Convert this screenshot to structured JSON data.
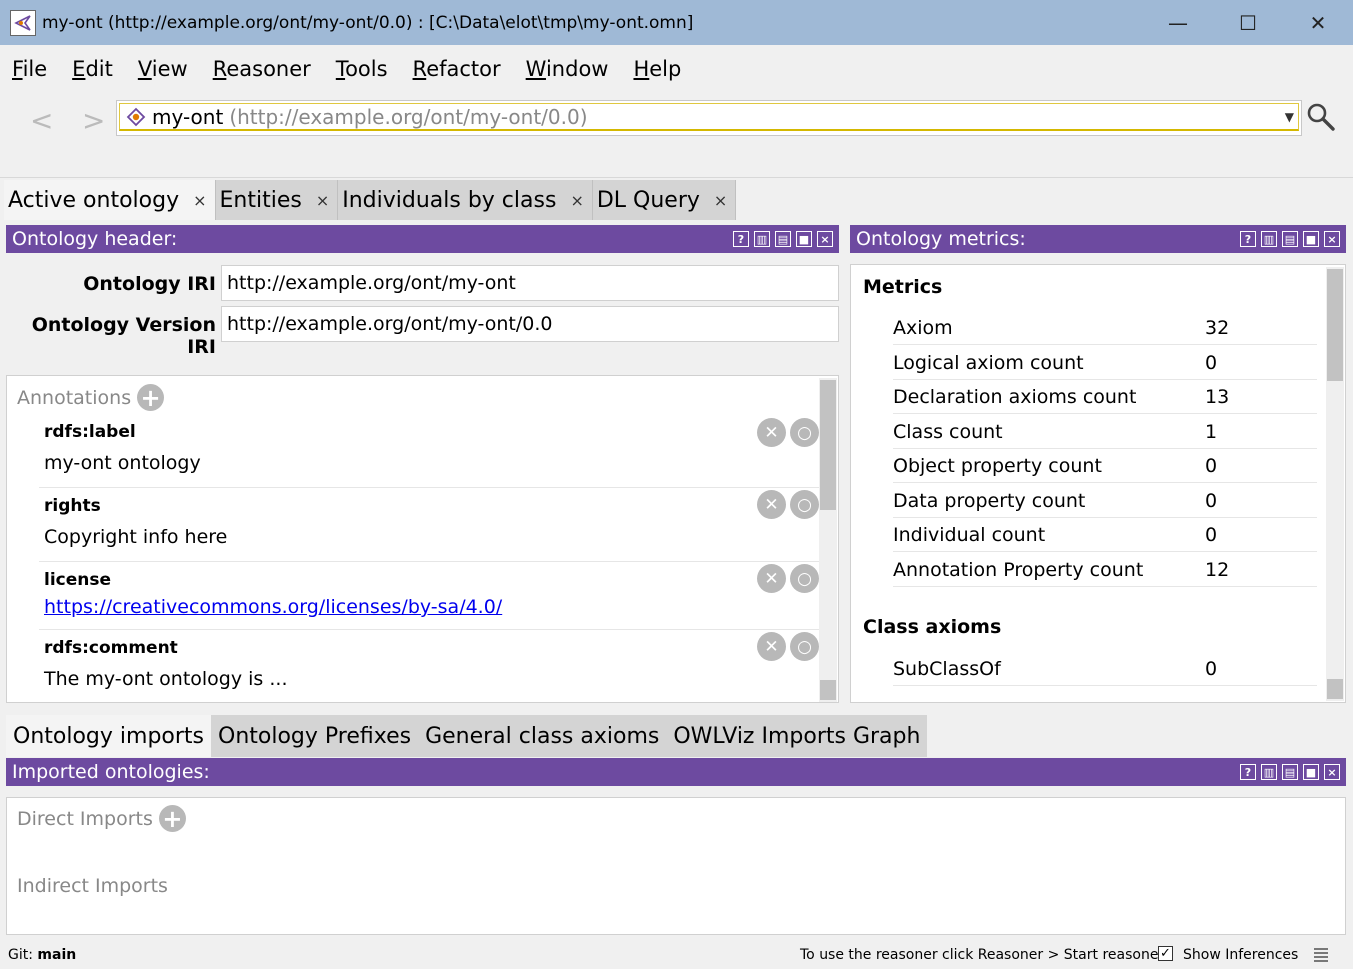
{
  "window": {
    "title": "my-ont (http://example.org/ont/my-ont/0.0)  : [C:\\Data\\elot\\tmp\\my-ont.omn]",
    "controls": {
      "minimize": "—",
      "maximize": "☐",
      "close": "✕"
    }
  },
  "menu": [
    {
      "mnemonic": "F",
      "rest": "ile"
    },
    {
      "mnemonic": "E",
      "rest": "dit"
    },
    {
      "mnemonic": "V",
      "rest": "iew"
    },
    {
      "mnemonic": "R",
      "rest": "easoner"
    },
    {
      "mnemonic": "T",
      "rest": "ools"
    },
    {
      "mnemonic": "R",
      "rest": "efactor"
    },
    {
      "mnemonic": "W",
      "rest": "indow"
    },
    {
      "mnemonic": "H",
      "rest": "elp"
    }
  ],
  "nav": {
    "back": "<",
    "forward": ">",
    "ontology_name": "my-ont",
    "ontology_iri": "(http://example.org/ont/my-ont/0.0)"
  },
  "tabs": [
    {
      "label": "Active ontology",
      "close": "×"
    },
    {
      "label": "Entities",
      "close": "×"
    },
    {
      "label": "Individuals by class",
      "close": "×"
    },
    {
      "label": "DL Query",
      "close": "×"
    }
  ],
  "view_buttons": [
    "?",
    "",
    "",
    "",
    "×"
  ],
  "header_view": {
    "title": "Ontology header:",
    "iri_label": "Ontology IRI",
    "iri_value": "http://example.org/ont/my-ont",
    "version_label": "Ontology Version IRI",
    "version_value": "http://example.org/ont/my-ont/0.0",
    "annotations_title": "Annotations",
    "annotations": [
      {
        "key": "rdfs:label",
        "value": "my-ont ontology"
      },
      {
        "key": "rights",
        "value": "Copyright info here"
      },
      {
        "key": "license",
        "value": "https://creativecommons.org/licenses/by-sa/4.0/"
      },
      {
        "key": "rdfs:comment",
        "value": "The my-ont ontology is ..."
      }
    ]
  },
  "metrics_view": {
    "title": "Ontology metrics:",
    "metrics_title": "Metrics",
    "metrics": [
      {
        "label": "Axiom",
        "value": "32"
      },
      {
        "label": "Logical axiom count",
        "value": "0"
      },
      {
        "label": "Declaration axioms count",
        "value": "13"
      },
      {
        "label": "Class count",
        "value": "1"
      },
      {
        "label": "Object property count",
        "value": "0"
      },
      {
        "label": "Data property count",
        "value": "0"
      },
      {
        "label": "Individual count",
        "value": "0"
      },
      {
        "label": "Annotation Property count",
        "value": "12"
      }
    ],
    "class_axioms_title": "Class axioms",
    "class_axioms": [
      {
        "label": "SubClassOf",
        "value": "0"
      }
    ]
  },
  "bottom_tabs": [
    {
      "label": "Ontology imports"
    },
    {
      "label": "Ontology Prefixes"
    },
    {
      "label": "General class axioms"
    },
    {
      "label": "OWLViz Imports Graph"
    }
  ],
  "imports_view": {
    "title": "Imported ontologies:",
    "direct": "Direct Imports",
    "indirect": "Indirect Imports"
  },
  "status": {
    "git_label": "Git:",
    "git_branch": "main",
    "reasoner_msg": "To use the reasoner click Reasoner > Start reasoner",
    "show_inferences": "Show Inferences",
    "show_inferences_checked": "✓"
  },
  "colors": {
    "view_header": "#6d4aa0",
    "title_bar": "#9fb9d6",
    "link": "#0000ee"
  }
}
